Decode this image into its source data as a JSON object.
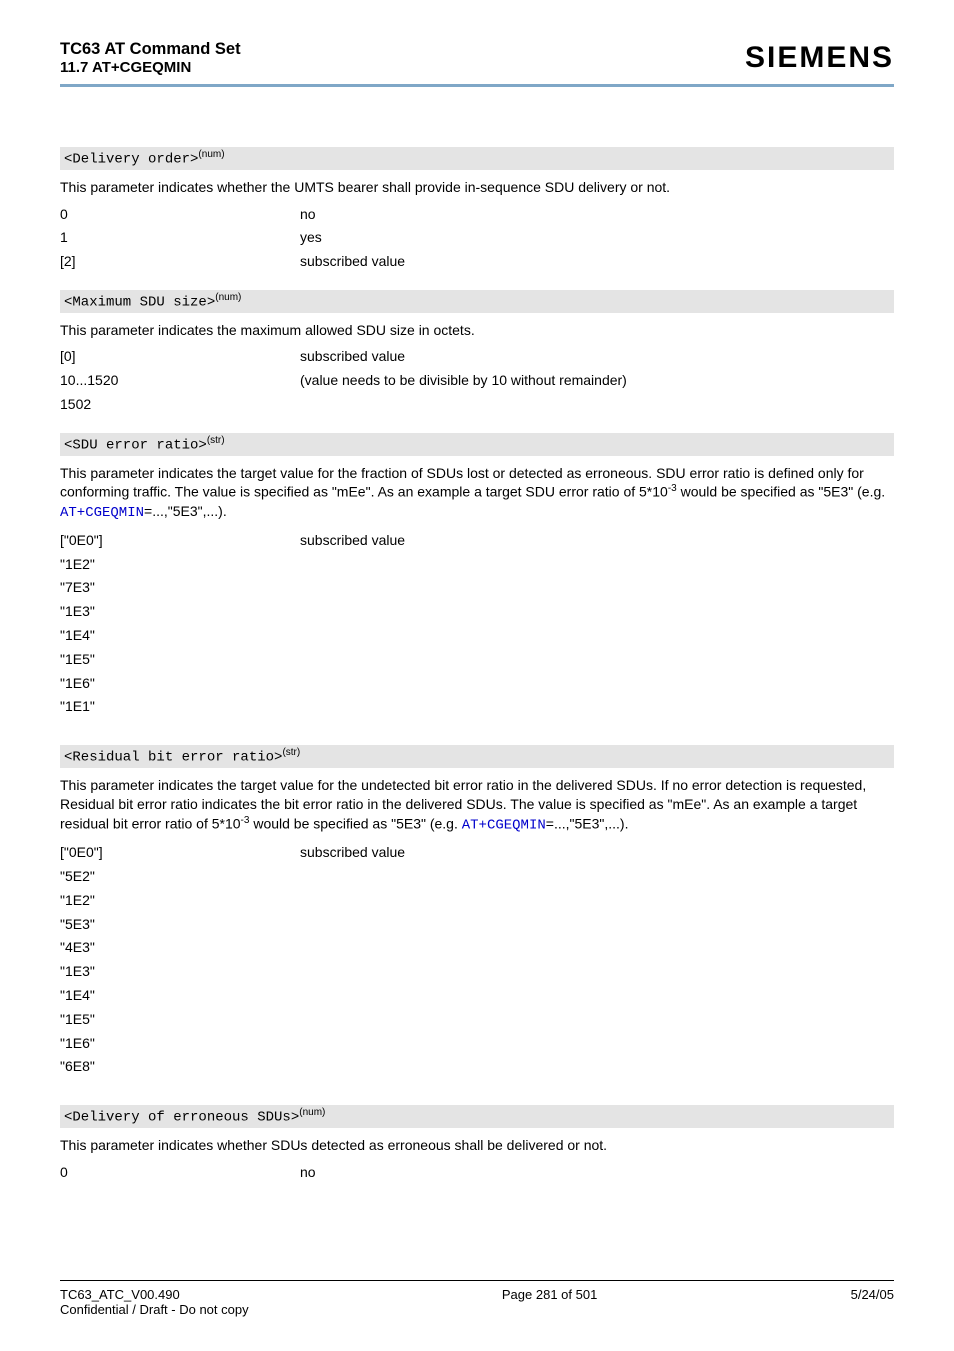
{
  "header": {
    "title": "TC63 AT Command Set",
    "subtitle": "11.7 AT+CGEQMIN",
    "brand": "SIEMENS"
  },
  "params": {
    "delivery_order": {
      "name": "<Delivery order>",
      "sup": "(num)",
      "desc_plain": "This parameter indicates whether the UMTS bearer shall provide in-sequence SDU delivery or not.",
      "rows": [
        {
          "k": "0",
          "v": "no"
        },
        {
          "k": "1",
          "v": "yes"
        },
        {
          "k": "[2]",
          "v": "subscribed value"
        }
      ]
    },
    "max_sdu_size": {
      "name": "<Maximum SDU size>",
      "sup": "(num)",
      "desc_plain": "This parameter indicates the maximum allowed SDU size in octets.",
      "rows": [
        {
          "k": "[0]",
          "v": "subscribed value"
        },
        {
          "k": "10...1520",
          "v": "(value needs to be divisible by 10 without remainder)"
        },
        {
          "k": "1502",
          "v": ""
        }
      ]
    },
    "sdu_error_ratio": {
      "name": "<SDU error ratio>",
      "sup": "(str)",
      "desc_pre": "This parameter indicates the target value for the fraction of SDUs lost or detected as erroneous. SDU error ratio is defined only for conforming traffic. The value is specified as \"mEe\". As an example a target SDU error ratio of 5*10",
      "desc_sup": "-3",
      "desc_mid": " would be specified as \"5E3\" (e.g. ",
      "link": "AT+CGEQMIN",
      "desc_post": "=...,\"5E3\",...).",
      "rows": [
        {
          "k": "[\"0E0\"]",
          "v": "subscribed value"
        },
        {
          "k": "\"1E2\"",
          "v": ""
        },
        {
          "k": "\"7E3\"",
          "v": ""
        },
        {
          "k": "\"1E3\"",
          "v": ""
        },
        {
          "k": "\"1E4\"",
          "v": ""
        },
        {
          "k": "\"1E5\"",
          "v": ""
        },
        {
          "k": "\"1E6\"",
          "v": ""
        },
        {
          "k": "\"1E1\"",
          "v": ""
        }
      ]
    },
    "residual_bit_error_ratio": {
      "name": "<Residual bit error ratio>",
      "sup": "(str)",
      "desc_pre": "This parameter indicates the target value for the undetected bit error ratio in the delivered SDUs. If no error detection is requested, Residual bit error ratio indicates the bit error ratio in the delivered SDUs. The value is specified as \"mEe\". As an example a target residual bit error ratio of 5*10",
      "desc_sup": "-3",
      "desc_mid": " would be specified as \"5E3\" (e.g. ",
      "link": "AT+CGEQMIN",
      "desc_post": "=...,\"5E3\",...).",
      "rows": [
        {
          "k": "[\"0E0\"]",
          "v": "subscribed value"
        },
        {
          "k": "\"5E2\"",
          "v": ""
        },
        {
          "k": "\"1E2\"",
          "v": ""
        },
        {
          "k": "\"5E3\"",
          "v": ""
        },
        {
          "k": "\"4E3\"",
          "v": ""
        },
        {
          "k": "\"1E3\"",
          "v": ""
        },
        {
          "k": "\"1E4\"",
          "v": ""
        },
        {
          "k": "\"1E5\"",
          "v": ""
        },
        {
          "k": "\"1E6\"",
          "v": ""
        },
        {
          "k": "\"6E8\"",
          "v": ""
        }
      ]
    },
    "delivery_erroneous": {
      "name": "<Delivery of erroneous SDUs>",
      "sup": "(num)",
      "desc_plain": "This parameter indicates whether SDUs detected as erroneous shall be delivered or not.",
      "rows": [
        {
          "k": "0",
          "v": "no"
        }
      ]
    }
  },
  "footer": {
    "left1": "TC63_ATC_V00.490",
    "left2": "Confidential / Draft - Do not copy",
    "center": "Page 281 of 501",
    "right": "5/24/05"
  }
}
